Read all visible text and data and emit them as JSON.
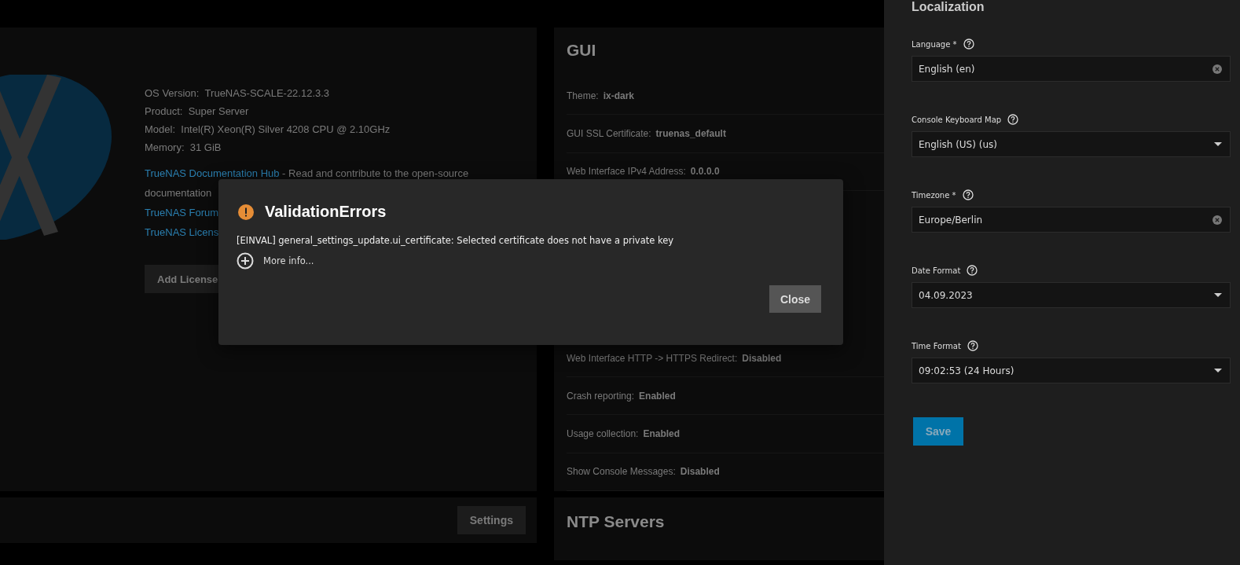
{
  "system_info": {
    "items": [
      {
        "label": "OS Version:",
        "value": "TrueNAS-SCALE-22.12.3.3"
      },
      {
        "label": "Product:",
        "value": "Super Server"
      },
      {
        "label": "Model:",
        "value": "Intel(R) Xeon(R) Silver 4208 CPU @ 2.10GHz"
      },
      {
        "label": "Memory:",
        "value": "31 GiB"
      }
    ],
    "doc_link": "TrueNAS Documentation Hub",
    "doc_text": " - Read and contribute to the open-source",
    "doc_text_2": "documentation",
    "links": [
      "TrueNAS Forum",
      "TrueNAS Licens"
    ],
    "button": "Add License"
  },
  "settings_button": "Settings",
  "gui": {
    "title": "GUI",
    "rows_top": [
      {
        "label": "Theme:",
        "value": "ix-dark"
      },
      {
        "label": "GUI SSL Certificate:",
        "value": "truenas_default"
      },
      {
        "label": "Web Interface IPv4 Address:",
        "value": "0.0.0.0"
      }
    ],
    "rows_bottom": [
      {
        "label": "Web Interface HTTP -> HTTPS Redirect:",
        "value": "Disabled"
      },
      {
        "label": "Crash reporting:",
        "value": "Enabled"
      },
      {
        "label": "Usage collection:",
        "value": "Enabled"
      },
      {
        "label": "Show Console Messages:",
        "value": "Disabled"
      }
    ]
  },
  "ntp": {
    "title": "NTP Servers"
  },
  "dialog": {
    "title": "ValidationErrors",
    "message": "[EINVAL] general_settings_update.ui_certificate: Selected certificate does not have a private key",
    "more_info": "More info...",
    "button": "Close"
  },
  "localization": {
    "title": "Localization",
    "fields": [
      {
        "label": "Language *",
        "value": "English (en)",
        "kind": "clearable"
      },
      {
        "label": "Console Keyboard Map",
        "value": "English (US) (us)",
        "kind": "select"
      },
      {
        "label": "Timezone *",
        "value": "Europe/Berlin",
        "kind": "clearable"
      },
      {
        "label": "Date Format",
        "value": "04.09.2023",
        "kind": "select"
      },
      {
        "label": "Time Format",
        "value": "09:02:53 (24 Hours)",
        "kind": "select"
      }
    ],
    "button": "Save"
  }
}
